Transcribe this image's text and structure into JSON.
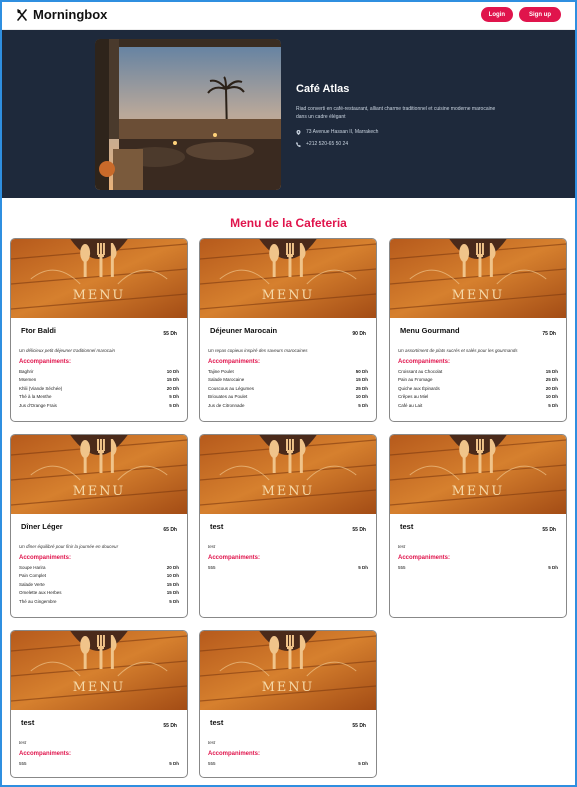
{
  "nav": {
    "brand": "Morningbox",
    "login": "Login",
    "signup": "Sign up"
  },
  "hero": {
    "title": "Café Atlas",
    "description": "Riad converti en café-restaurant, alliant charme traditionnel et cuisine moderne marocaine dans un cadre élégant",
    "address": "73 Avenue Hassan II, Marrakech",
    "phone": "+212 520-65 50 24"
  },
  "menu_title": "Menu de la Cafeteria",
  "accompaniments_label": "Accompaniments:",
  "image_text": "MENU",
  "cards": [
    {
      "title": "Ftor Baldi",
      "price": "55 Dh",
      "desc": "Un délicieux petit déjeuner traditionnel marocain",
      "items": [
        [
          "Baghrir",
          "10 Dh"
        ],
        [
          "Msemen",
          "15 Dh"
        ],
        [
          "Khlii (Viande Séchée)",
          "20 Dh"
        ],
        [
          "Thé à la Menthe",
          "5 Dh"
        ],
        [
          "Jus d'Orange Frais",
          "5 Dh"
        ]
      ]
    },
    {
      "title": "Déjeuner Marocain",
      "price": "90 Dh",
      "desc": "Un repas copieux inspiré des saveurs marocaines",
      "items": [
        [
          "Tajine Poulet",
          "50 Dh"
        ],
        [
          "Salade Marocaine",
          "15 Dh"
        ],
        [
          "Couscous au Légumes",
          "25 Dh"
        ],
        [
          "Briouates au Poulet",
          "10 Dh"
        ],
        [
          "Jus de Citronnade",
          "5 Dh"
        ]
      ]
    },
    {
      "title": "Menu Gourmand",
      "price": "75 Dh",
      "desc": "Un assortiment de plats sucrés et salés pour les gourmands",
      "items": [
        [
          "Croissant au Chocolat",
          "15 Dh"
        ],
        [
          "Pain au Fromage",
          "25 Dh"
        ],
        [
          "Quiche aux Épinards",
          "20 Dh"
        ],
        [
          "Crêpes au Miel",
          "10 Dh"
        ],
        [
          "Café au Lait",
          "5 Dh"
        ]
      ]
    },
    {
      "title": "Dîner Léger",
      "price": "65 Dh",
      "desc": "Un dîner équilibré pour finir la journée en douceur",
      "items": [
        [
          "Soupe Harira",
          "20 Dh"
        ],
        [
          "Pain Complet",
          "10 Dh"
        ],
        [
          "Salade Verte",
          "15 Dh"
        ],
        [
          "Omelette aux Herbes",
          "15 Dh"
        ],
        [
          "Thé au Gingembre",
          "5 Dh"
        ]
      ]
    },
    {
      "title": "test",
      "price": "55 Dh",
      "desc": "test",
      "items": [
        [
          "555",
          "5 Dh"
        ]
      ]
    },
    {
      "title": "test",
      "price": "55 Dh",
      "desc": "test",
      "items": [
        [
          "555",
          "5 Dh"
        ]
      ]
    },
    {
      "title": "test",
      "price": "55 Dh",
      "desc": "test",
      "items": [
        [
          "555",
          "5 Dh"
        ]
      ]
    },
    {
      "title": "test",
      "price": "55 Dh",
      "desc": "test",
      "items": [
        [
          "555",
          "5 Dh"
        ]
      ]
    }
  ],
  "colors": {
    "accent": "#e0144c",
    "hero_bg": "#1e293b",
    "frame": "#2f8fe0"
  }
}
